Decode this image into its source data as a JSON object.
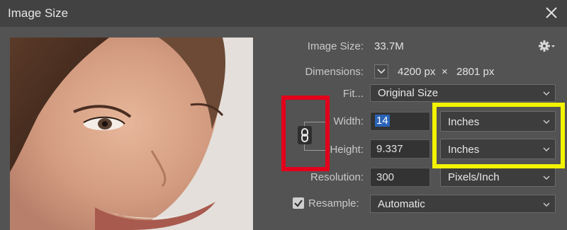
{
  "dialog": {
    "title": "Image Size"
  },
  "image_size": {
    "label": "Image Size:",
    "value": "33.7M"
  },
  "dimensions": {
    "label": "Dimensions:",
    "width": "4200 px",
    "times": "×",
    "height": "2801 px"
  },
  "fit": {
    "label": "Fit...",
    "value": "Original Size"
  },
  "width": {
    "label": "Width:",
    "value": "14",
    "unit": "Inches"
  },
  "height": {
    "label": "Height:",
    "value": "9.337",
    "unit": "Inches"
  },
  "resolution": {
    "label": "Resolution:",
    "value": "300",
    "unit": "Pixels/Inch"
  },
  "resample": {
    "label": "Resample:",
    "checked": true,
    "value": "Automatic"
  },
  "colors": {
    "highlight_red": "#e3001b",
    "highlight_yellow": "#f3f300",
    "selection": "#2a64b8"
  }
}
